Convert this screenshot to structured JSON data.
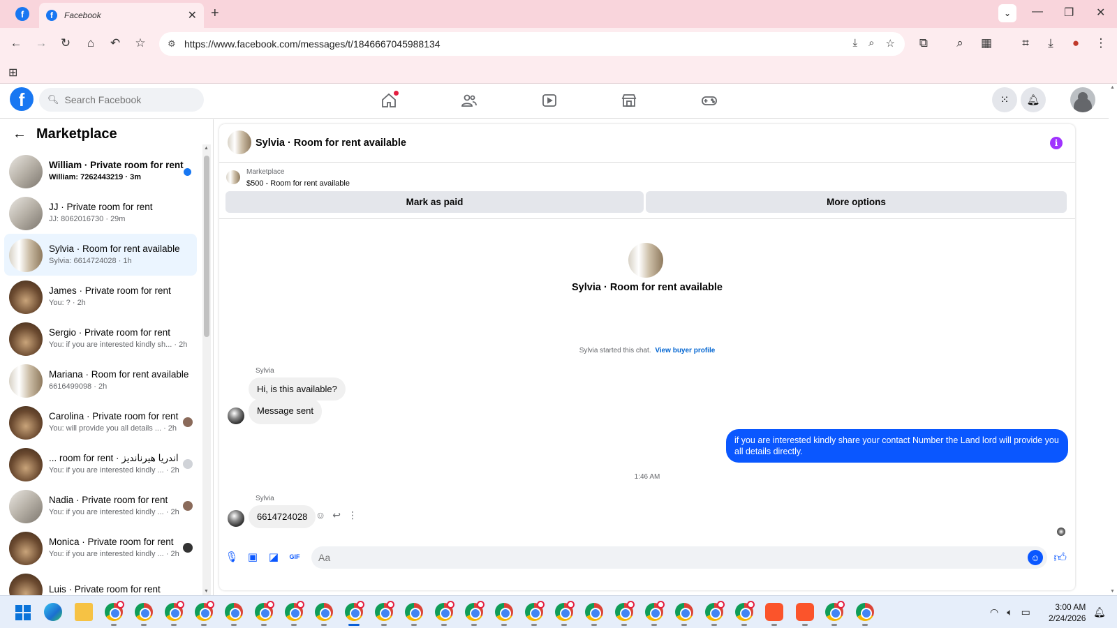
{
  "browser": {
    "tab_title": "Facebook",
    "url": "https://www.facebook.com/messages/t/1846667045988134"
  },
  "fb": {
    "search_placeholder": "Search Facebook"
  },
  "sidebar": {
    "title": "Marketplace",
    "conversations": [
      {
        "name": "William · Private room for rent",
        "snippet": "William: 7262443219 · 3m",
        "unread": true,
        "avatar": "room-light"
      },
      {
        "name": "JJ · Private room for rent",
        "snippet": "JJ: 8062016730 · 29m",
        "unread": false,
        "avatar": "room-light"
      },
      {
        "name": "Sylvia · Room for rent available",
        "snippet": "Sylvia: 6614724028 · 1h",
        "unread": false,
        "active": true,
        "avatar": "room-win"
      },
      {
        "name": "James · Private room for rent",
        "snippet": "You: ? · 2h",
        "unread": false,
        "avatar": "room-dark"
      },
      {
        "name": "Sergio · Private room for rent",
        "snippet": "You: if you are interested kindly sh... · 2h",
        "unread": false,
        "avatar": "room-dark"
      },
      {
        "name": "Mariana · Room for rent available",
        "snippet": "6616499098 · 2h",
        "unread": false,
        "avatar": "room-win"
      },
      {
        "name": "Carolina · Private room for rent",
        "snippet": "You: will provide you all details ... · 2h",
        "unread": false,
        "avatar": "room-dark"
      },
      {
        "name": "... room for rent · اندریا هیرناندیز",
        "snippet": "You: if you are interested kindly ... · 2h",
        "unread": false,
        "avatar": "room-dark"
      },
      {
        "name": "Nadia · Private room for rent",
        "snippet": "You: if you are interested kindly ... · 2h",
        "unread": false,
        "avatar": "room-light"
      },
      {
        "name": "Monica · Private room for rent",
        "snippet": "You: if you are interested kindly ... · 2h",
        "unread": false,
        "avatar": "room-dark"
      },
      {
        "name": "Luis · Private room for rent",
        "snippet": "",
        "unread": false,
        "avatar": "room-dark"
      }
    ]
  },
  "chat": {
    "title": "Sylvia · Room for rent available",
    "marketplace_label": "Marketplace",
    "listing": "$500 - Room for rent available",
    "mark_paid": "Mark as paid",
    "more_options": "More options",
    "intro_title": "Sylvia · Room for rent available",
    "started_text": "Sylvia started this chat.",
    "view_profile": "View buyer profile",
    "sender_name": "Sylvia",
    "msg1": "Hi, is this available?",
    "msg2": "Message sent",
    "out_msg": "if you are interested kindly share your contact Number the Land lord will provide you all details directly.",
    "timestamp": "1:46 AM",
    "msg3": "6614724028",
    "composer_placeholder": "Aa"
  },
  "taskbar": {
    "time": "3:00 AM",
    "date": "2/24/2026"
  },
  "colors": {
    "fb_blue": "#1877f2",
    "messenger_blue": "#0a57ff",
    "chrome_tab_bg": "#f9d5dc"
  }
}
